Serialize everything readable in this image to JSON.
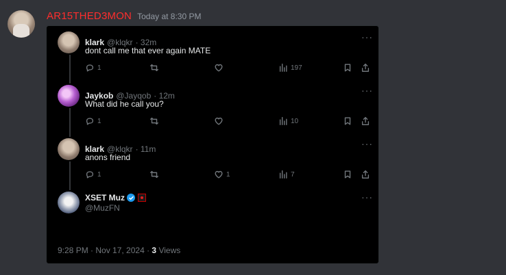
{
  "message": {
    "author": "AR15THED3MON",
    "timestamp": "Today at 8:30 PM",
    "author_color": "#ff2d2d"
  },
  "embed": {
    "tweets": [
      {
        "name": "klark",
        "handle": "@klqkr",
        "age": "· 32m",
        "text": "dont call me that ever again MATE",
        "replies": "1",
        "likes": "",
        "views": "197"
      },
      {
        "name": "Jaykob",
        "handle": "@Jayqob",
        "age": "· 12m",
        "text": "What did he call you?",
        "replies": "1",
        "likes": "",
        "views": "10"
      },
      {
        "name": "klark",
        "handle": "@klqkr",
        "age": "· 11m",
        "text": "anons friend",
        "replies": "1",
        "likes": "1",
        "views": "7"
      }
    ],
    "main": {
      "name": "XSET Muz",
      "handle": "@MuzFN",
      "text": "😭😭",
      "date": "9:28 PM · Nov 17, 2024 ·",
      "views_count": "3",
      "views_label": "Views"
    },
    "more_label": "···"
  }
}
